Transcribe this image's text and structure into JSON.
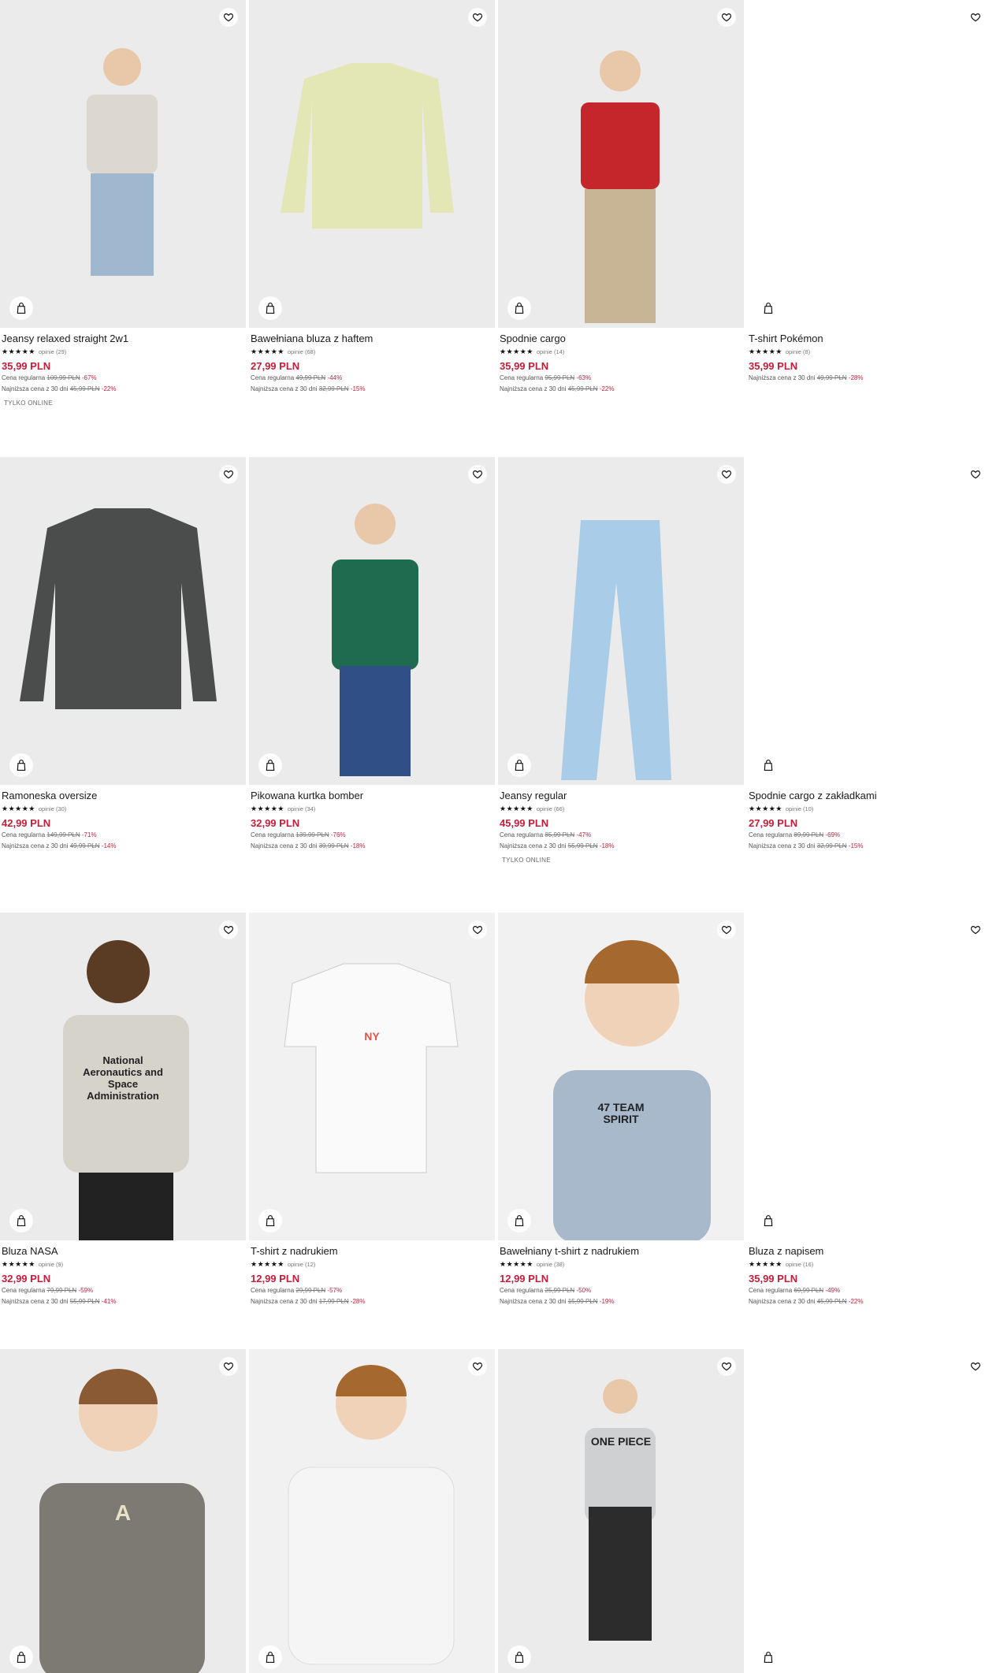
{
  "products": [
    {
      "name": "Jeansy relaxed straight 2w1",
      "rating_stars": "★★★★★",
      "reviews": "opinie (29)",
      "price": "35,99 PLN",
      "regular_label": "Cena regularna",
      "regular_price": "109,99 PLN",
      "regular_discount": "-67%",
      "lowest_label": "Najniższa cena z 30 dni",
      "lowest_price": "45,99 PLN",
      "lowest_discount": "-22%",
      "badge": "TYLKO ONLINE"
    },
    {
      "name": "Bawełniana bluza z haftem",
      "rating_stars": "★★★★★",
      "reviews": "opinie (68)",
      "price": "27,99 PLN",
      "regular_label": "Cena regularna",
      "regular_price": "49,99 PLN",
      "regular_discount": "-44%",
      "lowest_label": "Najniższa cena z 30 dni",
      "lowest_price": "32,99 PLN",
      "lowest_discount": "-15%"
    },
    {
      "name": "Spodnie cargo",
      "rating_stars": "★★★★★",
      "reviews": "opinie (14)",
      "price": "35,99 PLN",
      "regular_label": "Cena regularna",
      "regular_price": "95,99 PLN",
      "regular_discount": "-63%",
      "lowest_label": "Najniższa cena z 30 dni",
      "lowest_price": "45,99 PLN",
      "lowest_discount": "-22%"
    },
    {
      "name": "T-shirt Pokémon",
      "rating_stars": "★★★★★",
      "reviews": "opinie (8)",
      "price": "35,99 PLN",
      "lowest_label": "Najniższa cena z 30 dni",
      "lowest_price": "49,99 PLN",
      "lowest_discount": "-28%"
    },
    {
      "name": "Ramoneska oversize",
      "rating_stars": "★★★★★",
      "reviews": "opinie (30)",
      "price": "42,99 PLN",
      "regular_label": "Cena regularna",
      "regular_price": "149,99 PLN",
      "regular_discount": "-71%",
      "lowest_label": "Najniższa cena z 30 dni",
      "lowest_price": "49,99 PLN",
      "lowest_discount": "-14%"
    },
    {
      "name": "Pikowana kurtka bomber",
      "rating_stars": "★★★★★",
      "reviews": "opinie (34)",
      "price": "32,99 PLN",
      "regular_label": "Cena regularna",
      "regular_price": "139,99 PLN",
      "regular_discount": "-76%",
      "lowest_label": "Najniższa cena z 30 dni",
      "lowest_price": "39,99 PLN",
      "lowest_discount": "-18%"
    },
    {
      "name": "Jeansy regular",
      "rating_stars": "★★★★★",
      "reviews": "opinie (66)",
      "price": "45,99 PLN",
      "regular_label": "Cena regularna",
      "regular_price": "85,99 PLN",
      "regular_discount": "-47%",
      "lowest_label": "Najniższa cena z 30 dni",
      "lowest_price": "55,99 PLN",
      "lowest_discount": "-18%",
      "badge": "TYLKO ONLINE"
    },
    {
      "name": "Spodnie cargo z zakładkami",
      "rating_stars": "★★★★★",
      "reviews": "opinie (10)",
      "price": "27,99 PLN",
      "regular_label": "Cena regularna",
      "regular_price": "89,99 PLN",
      "regular_discount": "-69%",
      "lowest_label": "Najniższa cena z 30 dni",
      "lowest_price": "32,99 PLN",
      "lowest_discount": "-15%"
    },
    {
      "name": "Bluza NASA",
      "rating_stars": "★★★★★",
      "reviews": "opinie (9)",
      "price": "32,99 PLN",
      "regular_label": "Cena regularna",
      "regular_price": "79,99 PLN",
      "regular_discount": "-59%",
      "lowest_label": "Najniższa cena z 30 dni",
      "lowest_price": "55,99 PLN",
      "lowest_discount": "-41%",
      "image_text": "National Aeronautics and Space Administration"
    },
    {
      "name": "T-shirt z nadrukiem",
      "rating_stars": "★★★★★",
      "reviews": "opinie (12)",
      "price": "12,99 PLN",
      "regular_label": "Cena regularna",
      "regular_price": "29,99 PLN",
      "regular_discount": "-57%",
      "lowest_label": "Najniższa cena z 30 dni",
      "lowest_price": "17,99 PLN",
      "lowest_discount": "-28%",
      "image_text": "NY"
    },
    {
      "name": "Bawełniany t-shirt z nadrukiem",
      "rating_stars": "★★★★★",
      "reviews": "opinie (38)",
      "price": "12,99 PLN",
      "regular_label": "Cena regularna",
      "regular_price": "25,99 PLN",
      "regular_discount": "-50%",
      "lowest_label": "Najniższa cena z 30 dni",
      "lowest_price": "15,99 PLN",
      "lowest_discount": "-19%",
      "image_text": "47 TEAM SPIRIT"
    },
    {
      "name": "Bluza z napisem",
      "rating_stars": "★★★★★",
      "reviews": "opinie (16)",
      "price": "35,99 PLN",
      "regular_label": "Cena regularna",
      "regular_price": "69,99 PLN",
      "regular_discount": "-49%",
      "lowest_label": "Najniższa cena z 30 dni",
      "lowest_price": "45,99 PLN",
      "lowest_discount": "-22%"
    },
    {
      "image_text": "A"
    },
    {},
    {
      "image_text": "ONE PIECE"
    },
    {}
  ],
  "colors": {
    "price": "#c41e3a",
    "image_bg": "#ebebeb"
  },
  "icons": {
    "favorite": "heart-icon",
    "cart": "shopping-bag-icon"
  }
}
